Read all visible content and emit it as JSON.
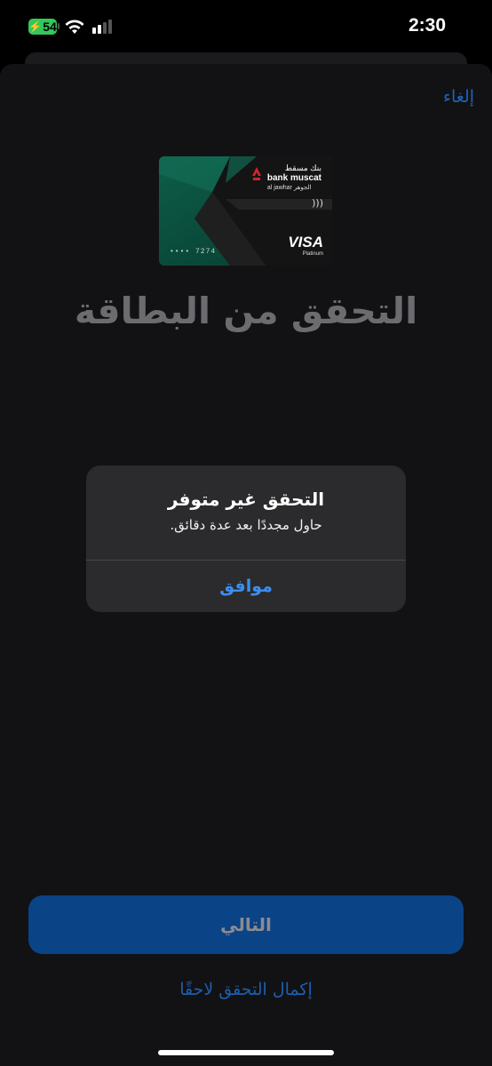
{
  "status_bar": {
    "battery": "54",
    "time": "2:30"
  },
  "header": {
    "cancel_label": "إلغاء"
  },
  "card": {
    "bank_name_ar": "بنك مسقط",
    "bank_name_en": "bank muscat",
    "tier_en": "al jawhar",
    "tier_ar": "الجوهر",
    "last_digits": "•••• 7274",
    "network": "VISA",
    "network_tier": "Platinum"
  },
  "page": {
    "title": "التحقق من البطاقة"
  },
  "alert": {
    "title": "التحقق غير متوفر",
    "message": "حاول مجددًا بعد عدة دقائق.",
    "ok_label": "موافق"
  },
  "footer": {
    "next_label": "التالي",
    "later_label": "إكمال التحقق لاحقًا"
  },
  "colors": {
    "accent": "#3d8ef0",
    "next_button_bg": "#0b4387",
    "battery_green": "#34c759"
  }
}
